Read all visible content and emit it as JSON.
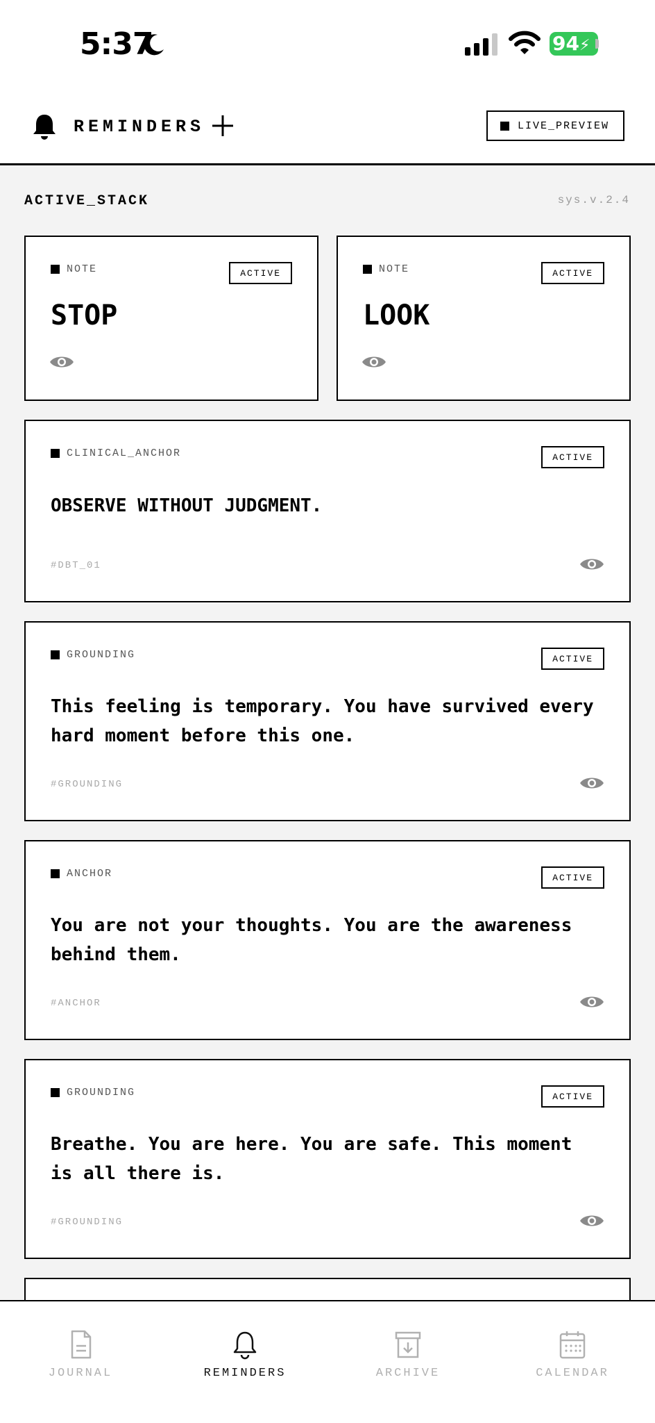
{
  "status_bar": {
    "time": "5:37",
    "battery": "94"
  },
  "header": {
    "title": "REMINDERS",
    "live_preview": "LIVE_PREVIEW"
  },
  "section": {
    "title": "ACTIVE_STACK",
    "version": "sys.v.2.4"
  },
  "small_cards": [
    {
      "category": "NOTE",
      "badge": "ACTIVE",
      "text": "STOP"
    },
    {
      "category": "NOTE",
      "badge": "ACTIVE",
      "text": "LOOK"
    }
  ],
  "cards": [
    {
      "category": "CLINICAL_ANCHOR",
      "badge": "ACTIVE",
      "text": "OBSERVE WITHOUT JUDGMENT.",
      "tag": "#DBT_01"
    },
    {
      "category": "GROUNDING",
      "badge": "ACTIVE",
      "text": "This feeling is temporary. You have survived every hard moment before this one.",
      "tag": "#GROUNDING"
    },
    {
      "category": "ANCHOR",
      "badge": "ACTIVE",
      "text": "You are not your thoughts. You are the awareness behind them.",
      "tag": "#ANCHOR"
    },
    {
      "category": "GROUNDING",
      "badge": "ACTIVE",
      "text": "Breathe. You are here. You are safe. This moment is all there is.",
      "tag": "#GROUNDING"
    }
  ],
  "nav": [
    {
      "label": "JOURNAL",
      "icon": "document-icon",
      "active": false
    },
    {
      "label": "REMINDERS",
      "icon": "bell-icon",
      "active": true
    },
    {
      "label": "ARCHIVE",
      "icon": "archive-icon",
      "active": false
    },
    {
      "label": "CALENDAR",
      "icon": "calendar-icon",
      "active": false
    }
  ],
  "colors": {
    "battery": "#34c759",
    "background": "#f3f3f3",
    "muted": "#a9a9a9"
  }
}
